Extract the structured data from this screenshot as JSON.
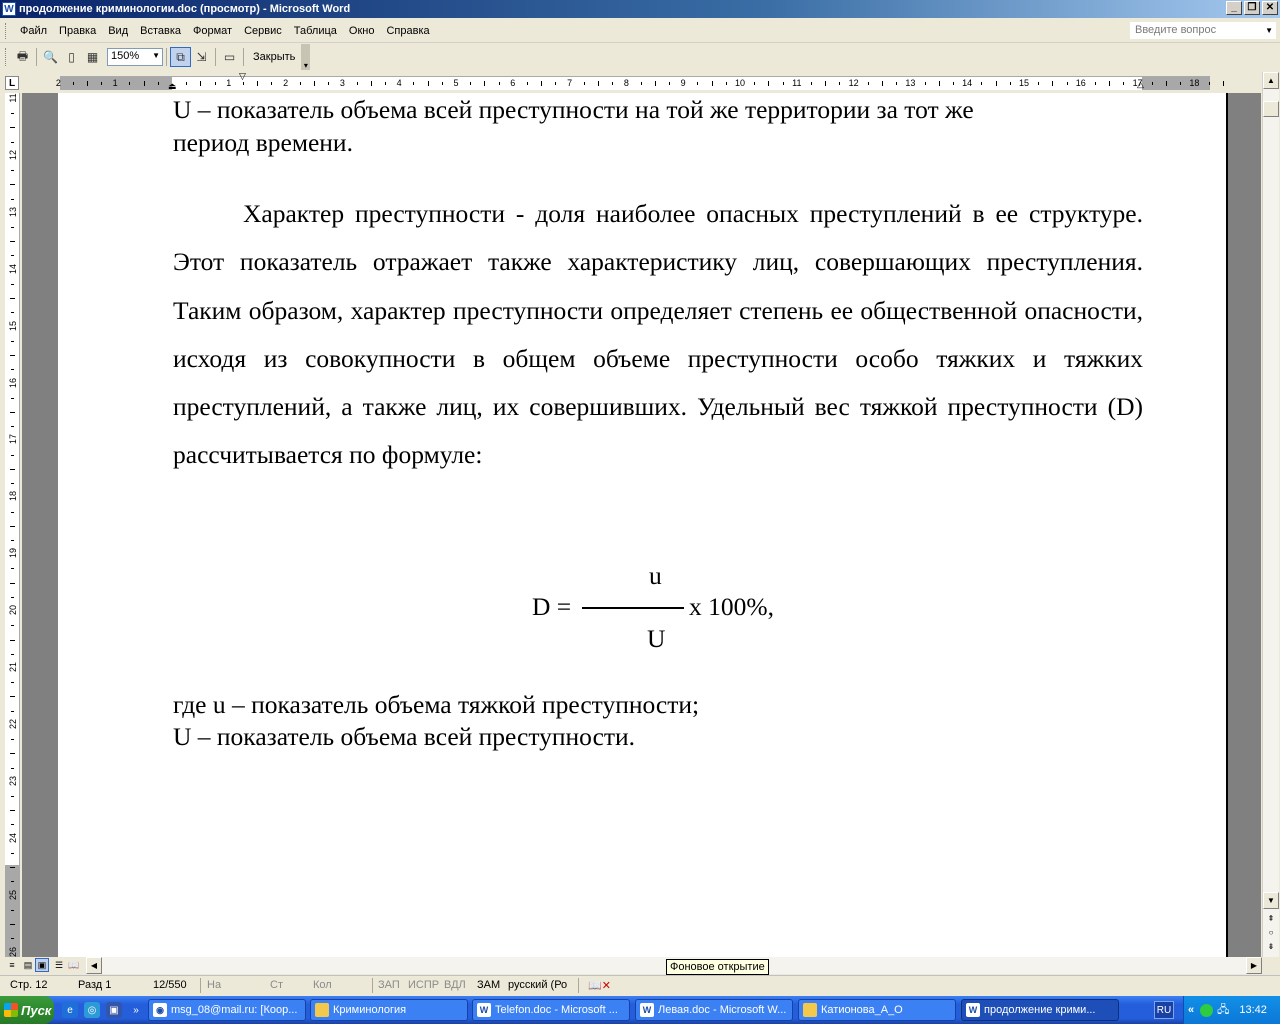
{
  "window": {
    "title": "продолжение криминологии.doc (просмотр) - Microsoft Word",
    "app_icon": "word-icon",
    "buttons": [
      "minimize",
      "restore",
      "close"
    ]
  },
  "menu": {
    "items": [
      "Файл",
      "Правка",
      "Вид",
      "Вставка",
      "Формат",
      "Сервис",
      "Таблица",
      "Окно",
      "Справка"
    ],
    "ask_placeholder": "Введите вопрос"
  },
  "toolbar": {
    "zoom": "150%",
    "close_label": "Закрыть"
  },
  "ruler": {
    "h_numbers": [
      "2",
      "1",
      "1",
      "2",
      "3",
      "4",
      "5",
      "6",
      "7",
      "8",
      "9",
      "10",
      "11",
      "12",
      "13",
      "14",
      "15",
      "16",
      "17",
      "18"
    ],
    "v_numbers": [
      "11",
      "12",
      "13",
      "14",
      "15",
      "16",
      "17",
      "18",
      "19",
      "20",
      "21",
      "22",
      "23",
      "24",
      "25",
      "26"
    ]
  },
  "document": {
    "line1": "U – показатель объема всей преступности на той же территории за тот же",
    "line2": "период времени.",
    "paragraph": "Характер преступности - доля наиболее опасных преступлений в ее структуре. Этот показатель отражает также характеристику лиц, совершающих преступления. Таким образом, характер преступности определяет степень ее общественной опасности, исходя из совокупности в общем объеме преступности особо тяжких и тяжких преступлений, а также лиц, их совершивших. Удельный вес тяжкой преступности (D) рассчитывается по формуле:",
    "formula": {
      "lhs": "D =",
      "numerator": "u",
      "denominator": "U",
      "rhs": "х 100%,"
    },
    "where1": "где u – показатель объема тяжкой преступности;",
    "where2": "U – показатель объема всей преступности."
  },
  "tooltip": "Фоновое открытие",
  "status": {
    "page": "Стр. 12",
    "section": "Разд 1",
    "pages": "12/550",
    "at": "На",
    "line": "Ст",
    "col": "Кол",
    "rec": "ЗАП",
    "trk": "ИСПР",
    "ext": "ВДЛ",
    "ovr": "ЗАМ",
    "language": "русский (Ро"
  },
  "taskbar": {
    "start": "Пуск",
    "tasks": [
      "msg_08@mail.ru: [Коор...",
      "Криминология",
      "Telefon.doc - Microsoft ...",
      "Левая.doc - Microsoft W...",
      "Катионова_А_О",
      "продолжение крими..."
    ],
    "language": "RU",
    "clock": "13:42"
  }
}
